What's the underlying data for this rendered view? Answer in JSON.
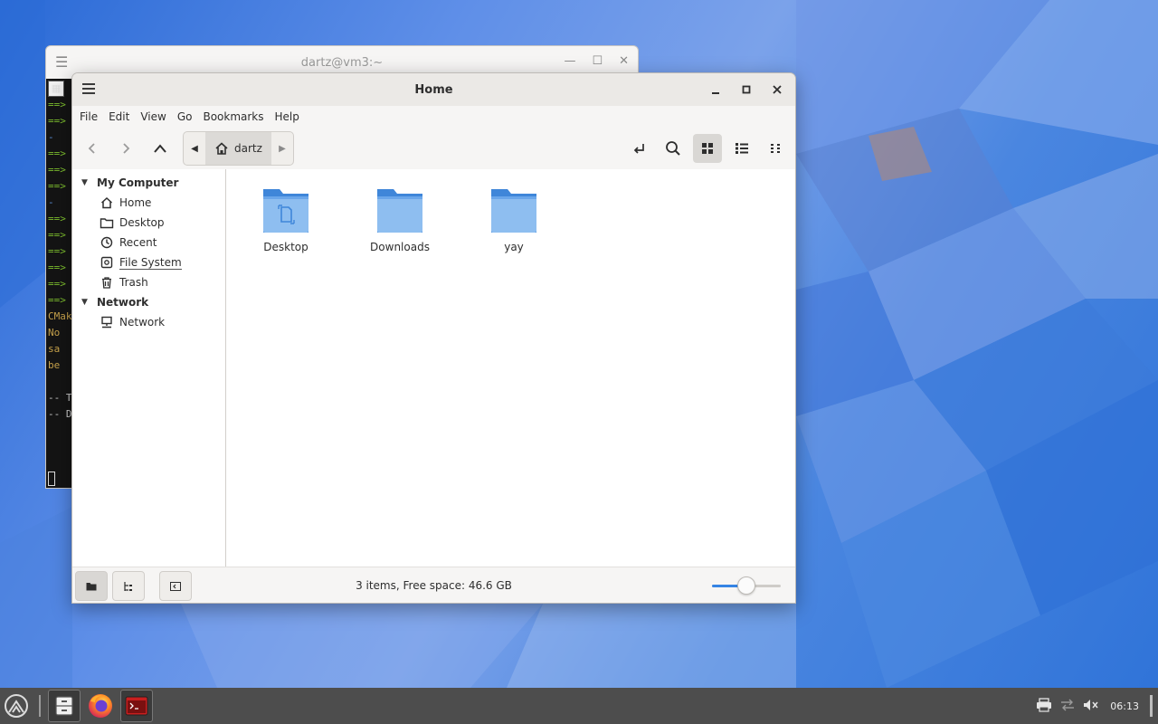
{
  "terminal": {
    "title": "dartz@vm3:~",
    "lines": [
      {
        "text": "==>",
        "color": "#7dbf2e"
      },
      {
        "text": "==>",
        "color": "#7dbf2e"
      },
      {
        "text": "  -",
        "color": "#5b8fd6"
      },
      {
        "text": "==>",
        "color": "#7dbf2e"
      },
      {
        "text": "==>",
        "color": "#7dbf2e"
      },
      {
        "text": "==>",
        "color": "#7dbf2e"
      },
      {
        "text": "  -",
        "color": "#5b8fd6"
      },
      {
        "text": "==>",
        "color": "#7dbf2e"
      },
      {
        "text": "==>",
        "color": "#7dbf2e"
      },
      {
        "text": "==>",
        "color": "#7dbf2e"
      },
      {
        "text": "==>",
        "color": "#7dbf2e"
      },
      {
        "text": "==>",
        "color": "#7dbf2e"
      },
      {
        "text": "==>",
        "color": "#7dbf2e"
      },
      {
        "text": "CMak",
        "color": "#c7a24b"
      },
      {
        "text": "  No",
        "color": "#c7a24b"
      },
      {
        "text": "  sa",
        "color": "#c7a24b"
      },
      {
        "text": "  be",
        "color": "#c7a24b"
      },
      {
        "text": "",
        "color": "#cccccc"
      },
      {
        "text": "-- T",
        "color": "#cccccc"
      },
      {
        "text": "-- D",
        "color": "#cccccc"
      }
    ]
  },
  "window": {
    "title": "Home",
    "menu": [
      "File",
      "Edit",
      "View",
      "Go",
      "Bookmarks",
      "Help"
    ],
    "path": {
      "current": "dartz"
    }
  },
  "sidebar": {
    "sections": [
      {
        "label": "My Computer",
        "items": [
          {
            "label": "Home",
            "icon": "home-icon"
          },
          {
            "label": "Desktop",
            "icon": "folder-icon"
          },
          {
            "label": "Recent",
            "icon": "clock-icon"
          },
          {
            "label": "File System",
            "icon": "drive-icon"
          },
          {
            "label": "Trash",
            "icon": "trash-icon"
          }
        ]
      },
      {
        "label": "Network",
        "items": [
          {
            "label": "Network",
            "icon": "network-icon"
          }
        ]
      }
    ]
  },
  "files": [
    {
      "name": "Desktop",
      "icon": "folder-desktop-icon"
    },
    {
      "name": "Downloads",
      "icon": "folder-icon"
    },
    {
      "name": "yay",
      "icon": "folder-icon"
    }
  ],
  "status": {
    "text": "3 items, Free space: 46.6 GB",
    "zoom_level": 0.5
  },
  "taskbar": {
    "clock": "06:13"
  },
  "colors": {
    "accent": "#3584e4",
    "folder": "#5aa0e8",
    "folder_dark": "#3f86d9"
  }
}
